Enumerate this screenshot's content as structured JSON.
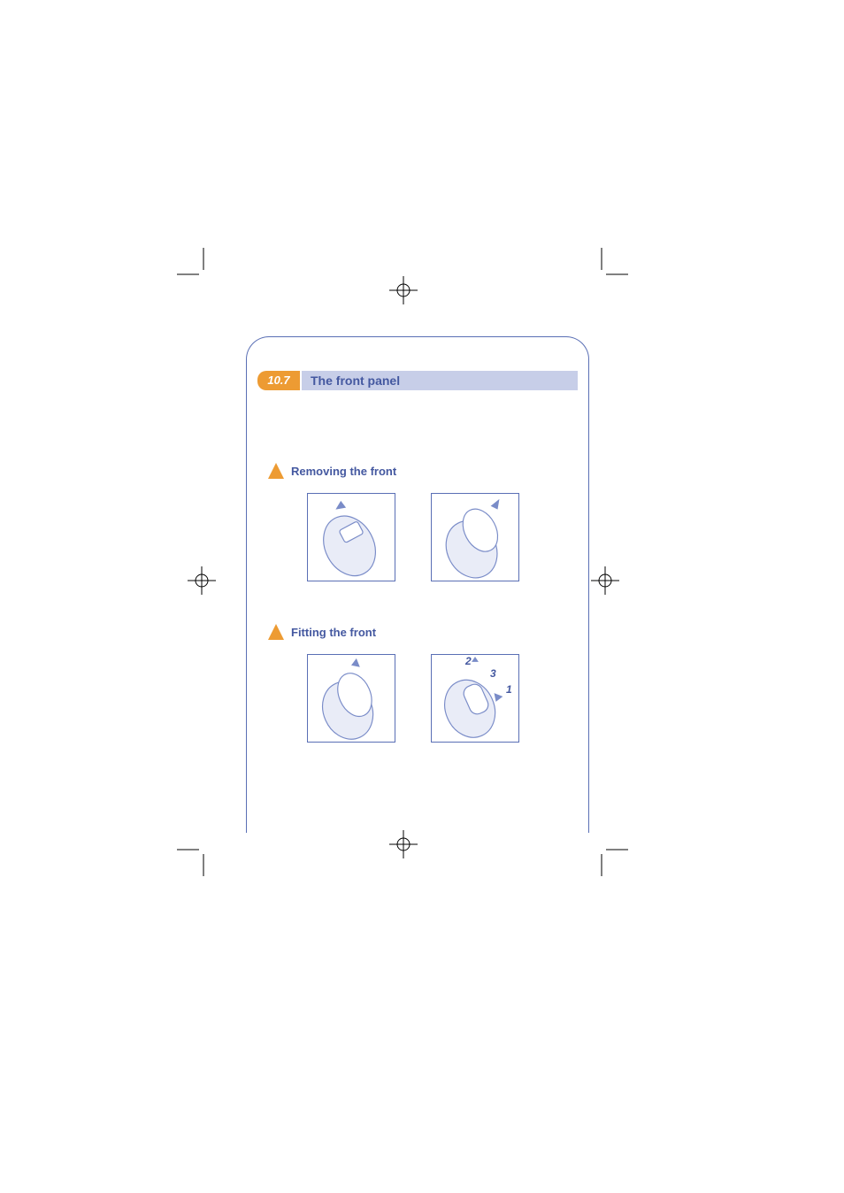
{
  "section_number": "10.7",
  "section_title": "The front panel",
  "subsection_1": "Removing the front",
  "subsection_2": "Fitting the front",
  "step_labels": {
    "one": "1",
    "two": "2",
    "three": "3"
  }
}
